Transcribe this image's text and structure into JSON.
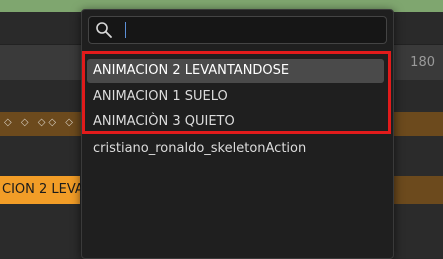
{
  "timeline": {
    "frame_number": "180",
    "strip_label": "CION 2 LEVAN",
    "keyframe_glyphs": "◇ ◇ ◇◇ ◇ ◇◇"
  },
  "search": {
    "value": "",
    "placeholder": ""
  },
  "action_list": {
    "items": [
      {
        "label": "ANIMACION 2 LEVANTANDOSE"
      },
      {
        "label": "ANIMACION 1 SUELO"
      },
      {
        "label": "ANIMACIÒN 3 QUIETO"
      },
      {
        "label": "cristiano_ronaldo_skeletonAction"
      }
    ]
  },
  "colors": {
    "highlight_box": "#e11b1b",
    "strip_orange": "#f29d27",
    "strip_brown": "#6c4a1d"
  }
}
